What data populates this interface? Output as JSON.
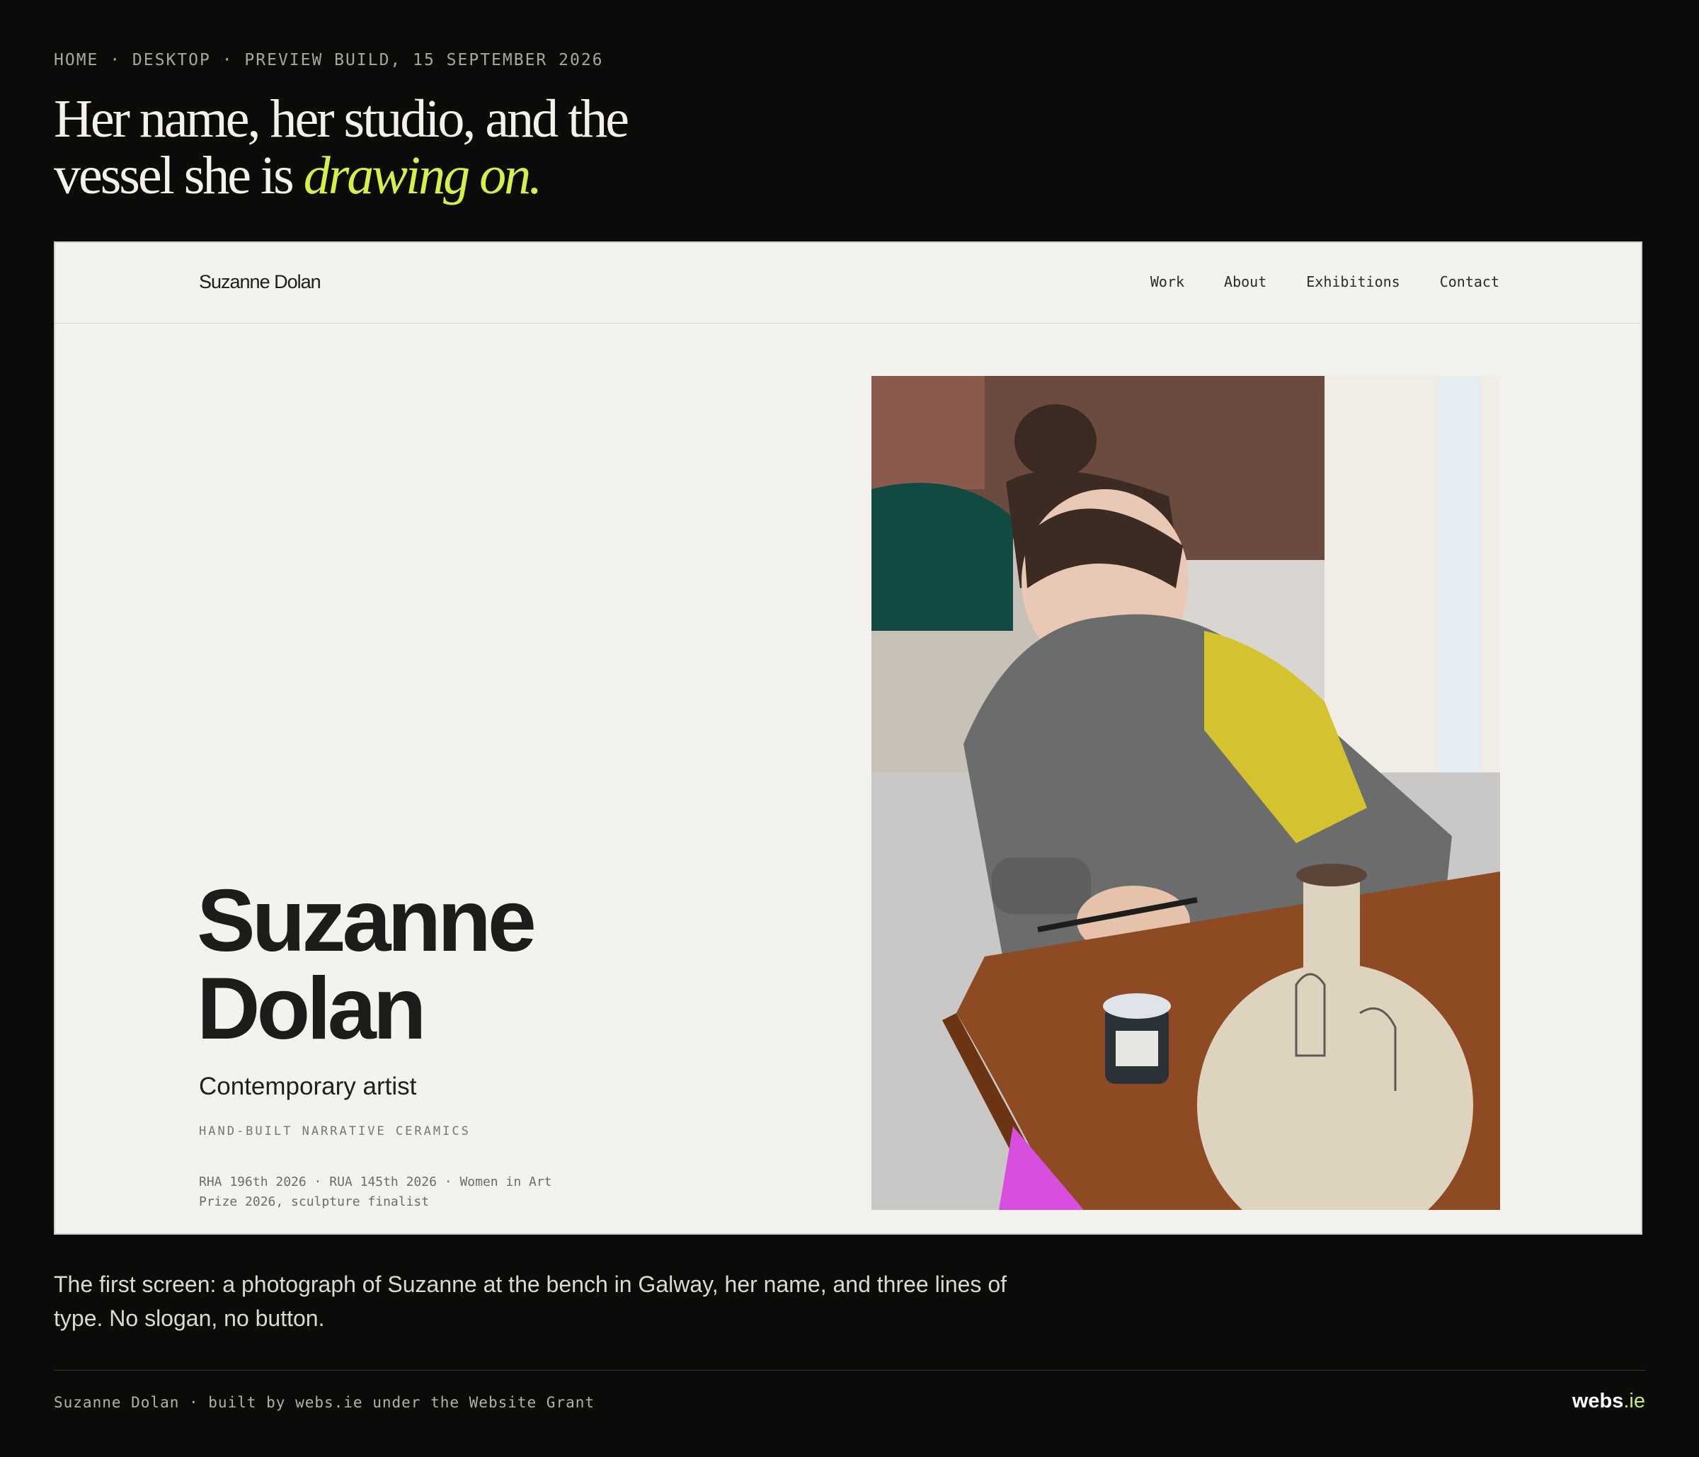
{
  "meta": {
    "breadcrumb": "HOME · DESKTOP · PREVIEW BUILD, 15 SEPTEMBER 2026"
  },
  "headline": {
    "line1": "Her name, her studio, and the",
    "line2_plain": "vessel she is ",
    "line2_accent": "drawing on."
  },
  "site": {
    "logo": "Suzanne Dolan",
    "nav": [
      "Work",
      "About",
      "Exhibitions",
      "Contact"
    ],
    "hero": {
      "name_line1": "Suzanne",
      "name_line2": "Dolan",
      "role": "Contemporary artist",
      "discipline": "HAND-BUILT NARRATIVE CERAMICS",
      "awards_line1": "RHA 196th 2026 · RUA 145th 2026 · Women in Art",
      "awards_line2": "Prize 2026, sculpture finalist"
    }
  },
  "caption": "The first screen: a photograph of Suzanne at the bench in Galway, her name, and three lines of type. No slogan, no button.",
  "footer": {
    "credit": "Suzanne Dolan · built by webs.ie under the Website Grant",
    "brand_name": "webs",
    "brand_tld": ".ie"
  },
  "colors": {
    "page_bg": "#0b0b0a",
    "accent": "#d6f04a",
    "frame_bg": "#f3f2ef"
  }
}
